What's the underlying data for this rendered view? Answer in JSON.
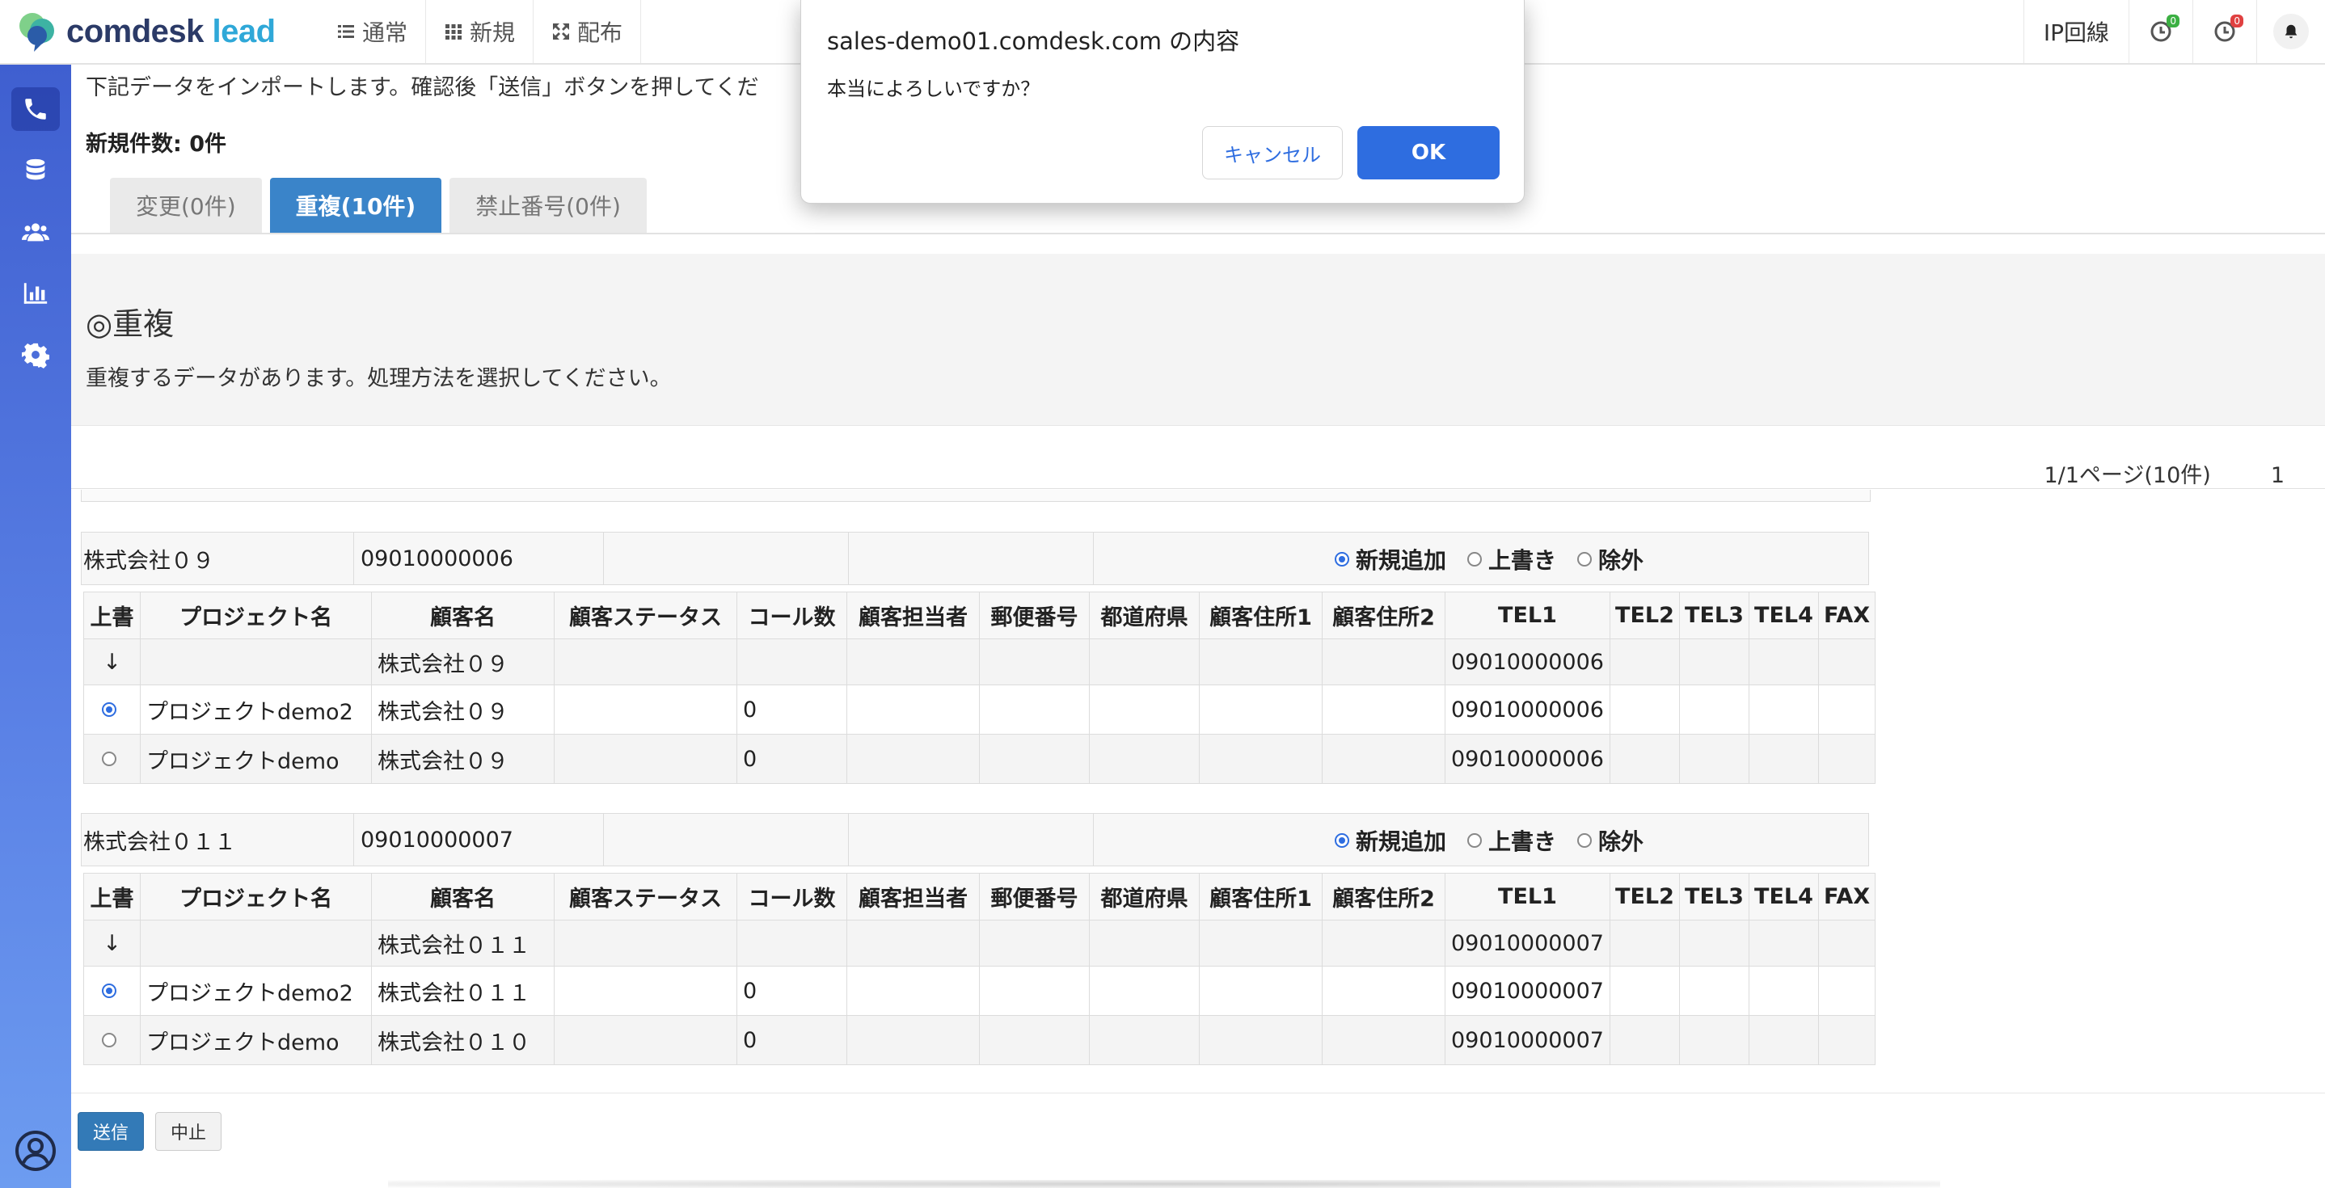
{
  "app": {
    "logo_main": "comdesk",
    "logo_accent": "lead"
  },
  "nav": {
    "items": [
      {
        "label": "通常",
        "icon": "list-icon"
      },
      {
        "label": "新規",
        "icon": "grid-icon"
      },
      {
        "label": "配布",
        "icon": "expand-icon"
      }
    ],
    "ip_line": "IP回線",
    "badge_green": "0",
    "badge_red": "0"
  },
  "content": {
    "intro": "下記データをインポートします。確認後「送信」ボタンを押してくだ",
    "new_count": "新規件数: 0件",
    "tabs": [
      "変更(0件)",
      "重複(10件)",
      "禁止番号(0件)"
    ],
    "active_tab": 1,
    "section_title": "◎重複",
    "section_desc": "重複するデータがあります。処理方法を選択してください。",
    "pager_info": "1/1ページ(10件)",
    "pager_page": "1"
  },
  "options": [
    "新規追加",
    "上書き",
    "除外"
  ],
  "columns": [
    "上書",
    "プロジェクト名",
    "顧客名",
    "顧客ステータス",
    "コール数",
    "顧客担当者",
    "郵便番号",
    "都道府県",
    "顧客住所1",
    "顧客住所2",
    "TEL1",
    "TEL2",
    "TEL3",
    "TEL4",
    "FAX"
  ],
  "groups": [
    {
      "name": "株式会社０９",
      "tel": "09010000006",
      "selected_option": 0,
      "arrow": "↓",
      "import_row": {
        "customer": "株式会社０９",
        "tel1": "09010000006"
      },
      "rows": [
        {
          "selected": true,
          "project": "プロジェクトdemo2",
          "customer": "株式会社０９",
          "calls": "0",
          "tel1": "09010000006"
        },
        {
          "selected": false,
          "project": "プロジェクトdemo",
          "customer": "株式会社０９",
          "calls": "0",
          "tel1": "09010000006"
        }
      ]
    },
    {
      "name": "株式会社０１１",
      "tel": "09010000007",
      "selected_option": 0,
      "arrow": "↓",
      "import_row": {
        "customer": "株式会社０１１",
        "tel1": "09010000007"
      },
      "rows": [
        {
          "selected": true,
          "project": "プロジェクトdemo2",
          "customer": "株式会社０１１",
          "calls": "0",
          "tel1": "09010000007"
        },
        {
          "selected": false,
          "project": "プロジェクトdemo",
          "customer": "株式会社０１０",
          "calls": "0",
          "tel1": "09010000007"
        }
      ]
    }
  ],
  "buttons": {
    "send": "送信",
    "stop": "中止"
  },
  "dialog": {
    "title": "sales-demo01.comdesk.com の内容",
    "message": "本当によろしいですか？",
    "cancel": "キャンセル",
    "ok": "OK"
  },
  "colors": {
    "accent": "#2e6de0",
    "tab_active": "#3a84c9",
    "sidebar_top": "#3f5fd0",
    "sidebar_bottom": "#6d9cf0"
  }
}
